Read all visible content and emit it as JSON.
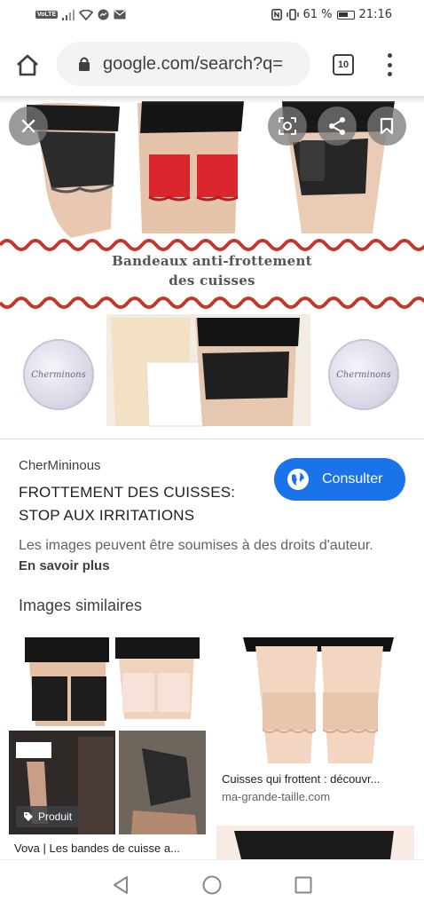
{
  "status_bar": {
    "left_badge": "VoLTE",
    "battery_text": "61 %",
    "time": "21:16"
  },
  "browser": {
    "url": "google.com/search?q=",
    "tab_count": "10",
    "icons": [
      "home-icon",
      "lock-icon",
      "tabs-icon",
      "more-vert-icon"
    ]
  },
  "hero": {
    "caption_line1": "Bandeaux anti-frottement",
    "caption_line2": "des cuisses",
    "seal_text": "Cherminons",
    "accent_red": "#c0392b",
    "overlay_icons": [
      "close-icon",
      "lens-icon",
      "share-icon",
      "bookmark-icon"
    ]
  },
  "result": {
    "source": "CherMininous",
    "title": "FROTTEMENT DES CUISSES: STOP AUX IRRITATIONS",
    "consult_label": "Consulter",
    "rights_text": "Les images peuvent être soumises à des droits d'auteur.",
    "learn_more": "En savoir plus",
    "similar_title": "Images similaires",
    "button_color": "#1a73e8"
  },
  "similar": [
    {
      "title": "Vova | Les bandes de cuisse a...",
      "domain": "",
      "badge": "Produit"
    },
    {
      "title": "Cuisses qui frottent : découvr...",
      "domain": "ma-grande-taille.com",
      "badge": ""
    }
  ],
  "nav": {
    "icons": [
      "back-icon",
      "home-circle-icon",
      "recents-icon"
    ]
  }
}
